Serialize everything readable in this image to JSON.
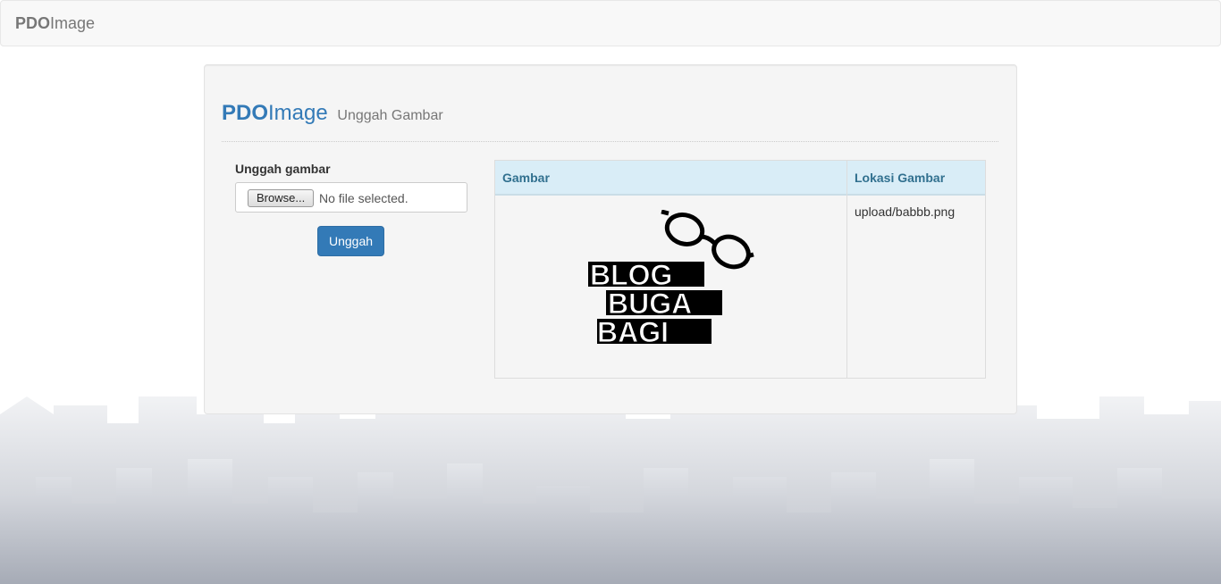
{
  "navbar": {
    "brand_bold": "PDO",
    "brand_rest": "Image"
  },
  "header": {
    "title_bold": "PDO",
    "title_rest": "Image",
    "subtitle": "Unggah Gambar"
  },
  "upload_form": {
    "label": "Unggah gambar",
    "browse_label": "Browse...",
    "file_status": "No file selected.",
    "submit_label": "Unggah"
  },
  "table": {
    "columns": [
      "Gambar",
      "Lokasi Gambar"
    ],
    "rows": [
      {
        "image_text": [
          "BLOG",
          "BUGA",
          "BAGI"
        ],
        "location": "upload/babbb.png"
      }
    ]
  },
  "colors": {
    "primary": "#337ab7",
    "table_header_bg": "#d9edf7",
    "table_header_text": "#31708f"
  }
}
